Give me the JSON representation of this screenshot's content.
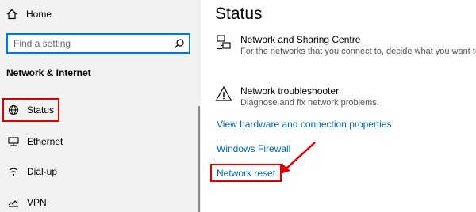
{
  "sidebar": {
    "home": {
      "label": "Home",
      "icon": "home-icon"
    },
    "search": {
      "placeholder": "Find a setting",
      "icon": "search-icon"
    },
    "section_title": "Network & Internet",
    "items": [
      {
        "label": "Status",
        "icon": "globe-icon"
      },
      {
        "label": "Ethernet",
        "icon": "ethernet-icon"
      },
      {
        "label": "Dial-up",
        "icon": "dialup-icon"
      },
      {
        "label": "VPN",
        "icon": "vpn-icon"
      }
    ]
  },
  "main": {
    "title": "Status",
    "entries": [
      {
        "heading": "Network and Sharing Centre",
        "description": "For the networks that you connect to, decide what you want to",
        "icon": "network-sharing-icon"
      },
      {
        "heading": "Network troubleshooter",
        "description": "Diagnose and fix network problems.",
        "icon": "warning-icon"
      }
    ],
    "links": {
      "hardware": "View hardware and connection properties",
      "firewall": "Windows Firewall",
      "reset": "Network reset"
    }
  },
  "colors": {
    "accent": "#0078d7",
    "link": "#0067b8",
    "highlight": "#e00000",
    "sidebar_bg": "#f2f2f2"
  }
}
